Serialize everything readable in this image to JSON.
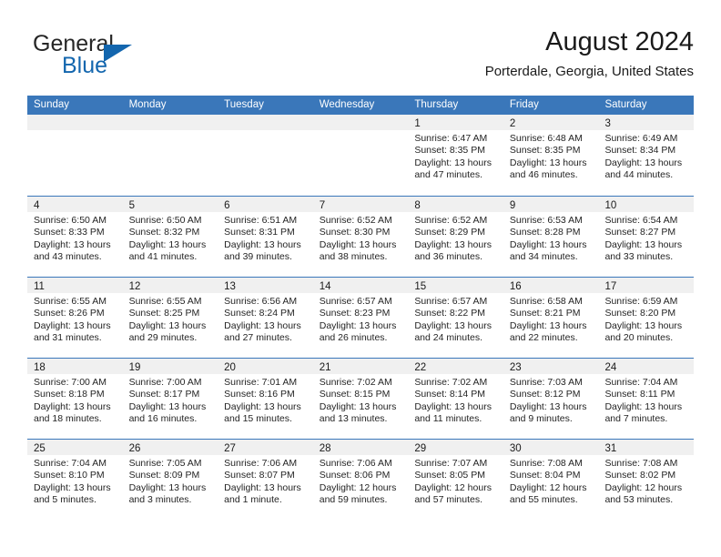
{
  "brand": {
    "word_one": "General",
    "word_two": "Blue",
    "flag_icon": "blue-triangle-flag-icon"
  },
  "header": {
    "title": "August 2024",
    "subtitle": "Porterdale, Georgia, United States"
  },
  "colors": {
    "header_blue": "#3a77ba",
    "brand_blue": "#1366ae",
    "day_band_gray": "#f0f0f0",
    "text": "#1a1a1a"
  },
  "weekdays": [
    "Sunday",
    "Monday",
    "Tuesday",
    "Wednesday",
    "Thursday",
    "Friday",
    "Saturday"
  ],
  "weeks": [
    [
      {
        "day": "",
        "sunrise": "",
        "sunset": "",
        "daylight": "",
        "daylight2": ""
      },
      {
        "day": "",
        "sunrise": "",
        "sunset": "",
        "daylight": "",
        "daylight2": ""
      },
      {
        "day": "",
        "sunrise": "",
        "sunset": "",
        "daylight": "",
        "daylight2": ""
      },
      {
        "day": "",
        "sunrise": "",
        "sunset": "",
        "daylight": "",
        "daylight2": ""
      },
      {
        "day": "1",
        "sunrise": "Sunrise: 6:47 AM",
        "sunset": "Sunset: 8:35 PM",
        "daylight": "Daylight: 13 hours",
        "daylight2": "and 47 minutes."
      },
      {
        "day": "2",
        "sunrise": "Sunrise: 6:48 AM",
        "sunset": "Sunset: 8:35 PM",
        "daylight": "Daylight: 13 hours",
        "daylight2": "and 46 minutes."
      },
      {
        "day": "3",
        "sunrise": "Sunrise: 6:49 AM",
        "sunset": "Sunset: 8:34 PM",
        "daylight": "Daylight: 13 hours",
        "daylight2": "and 44 minutes."
      }
    ],
    [
      {
        "day": "4",
        "sunrise": "Sunrise: 6:50 AM",
        "sunset": "Sunset: 8:33 PM",
        "daylight": "Daylight: 13 hours",
        "daylight2": "and 43 minutes."
      },
      {
        "day": "5",
        "sunrise": "Sunrise: 6:50 AM",
        "sunset": "Sunset: 8:32 PM",
        "daylight": "Daylight: 13 hours",
        "daylight2": "and 41 minutes."
      },
      {
        "day": "6",
        "sunrise": "Sunrise: 6:51 AM",
        "sunset": "Sunset: 8:31 PM",
        "daylight": "Daylight: 13 hours",
        "daylight2": "and 39 minutes."
      },
      {
        "day": "7",
        "sunrise": "Sunrise: 6:52 AM",
        "sunset": "Sunset: 8:30 PM",
        "daylight": "Daylight: 13 hours",
        "daylight2": "and 38 minutes."
      },
      {
        "day": "8",
        "sunrise": "Sunrise: 6:52 AM",
        "sunset": "Sunset: 8:29 PM",
        "daylight": "Daylight: 13 hours",
        "daylight2": "and 36 minutes."
      },
      {
        "day": "9",
        "sunrise": "Sunrise: 6:53 AM",
        "sunset": "Sunset: 8:28 PM",
        "daylight": "Daylight: 13 hours",
        "daylight2": "and 34 minutes."
      },
      {
        "day": "10",
        "sunrise": "Sunrise: 6:54 AM",
        "sunset": "Sunset: 8:27 PM",
        "daylight": "Daylight: 13 hours",
        "daylight2": "and 33 minutes."
      }
    ],
    [
      {
        "day": "11",
        "sunrise": "Sunrise: 6:55 AM",
        "sunset": "Sunset: 8:26 PM",
        "daylight": "Daylight: 13 hours",
        "daylight2": "and 31 minutes."
      },
      {
        "day": "12",
        "sunrise": "Sunrise: 6:55 AM",
        "sunset": "Sunset: 8:25 PM",
        "daylight": "Daylight: 13 hours",
        "daylight2": "and 29 minutes."
      },
      {
        "day": "13",
        "sunrise": "Sunrise: 6:56 AM",
        "sunset": "Sunset: 8:24 PM",
        "daylight": "Daylight: 13 hours",
        "daylight2": "and 27 minutes."
      },
      {
        "day": "14",
        "sunrise": "Sunrise: 6:57 AM",
        "sunset": "Sunset: 8:23 PM",
        "daylight": "Daylight: 13 hours",
        "daylight2": "and 26 minutes."
      },
      {
        "day": "15",
        "sunrise": "Sunrise: 6:57 AM",
        "sunset": "Sunset: 8:22 PM",
        "daylight": "Daylight: 13 hours",
        "daylight2": "and 24 minutes."
      },
      {
        "day": "16",
        "sunrise": "Sunrise: 6:58 AM",
        "sunset": "Sunset: 8:21 PM",
        "daylight": "Daylight: 13 hours",
        "daylight2": "and 22 minutes."
      },
      {
        "day": "17",
        "sunrise": "Sunrise: 6:59 AM",
        "sunset": "Sunset: 8:20 PM",
        "daylight": "Daylight: 13 hours",
        "daylight2": "and 20 minutes."
      }
    ],
    [
      {
        "day": "18",
        "sunrise": "Sunrise: 7:00 AM",
        "sunset": "Sunset: 8:18 PM",
        "daylight": "Daylight: 13 hours",
        "daylight2": "and 18 minutes."
      },
      {
        "day": "19",
        "sunrise": "Sunrise: 7:00 AM",
        "sunset": "Sunset: 8:17 PM",
        "daylight": "Daylight: 13 hours",
        "daylight2": "and 16 minutes."
      },
      {
        "day": "20",
        "sunrise": "Sunrise: 7:01 AM",
        "sunset": "Sunset: 8:16 PM",
        "daylight": "Daylight: 13 hours",
        "daylight2": "and 15 minutes."
      },
      {
        "day": "21",
        "sunrise": "Sunrise: 7:02 AM",
        "sunset": "Sunset: 8:15 PM",
        "daylight": "Daylight: 13 hours",
        "daylight2": "and 13 minutes."
      },
      {
        "day": "22",
        "sunrise": "Sunrise: 7:02 AM",
        "sunset": "Sunset: 8:14 PM",
        "daylight": "Daylight: 13 hours",
        "daylight2": "and 11 minutes."
      },
      {
        "day": "23",
        "sunrise": "Sunrise: 7:03 AM",
        "sunset": "Sunset: 8:12 PM",
        "daylight": "Daylight: 13 hours",
        "daylight2": "and 9 minutes."
      },
      {
        "day": "24",
        "sunrise": "Sunrise: 7:04 AM",
        "sunset": "Sunset: 8:11 PM",
        "daylight": "Daylight: 13 hours",
        "daylight2": "and 7 minutes."
      }
    ],
    [
      {
        "day": "25",
        "sunrise": "Sunrise: 7:04 AM",
        "sunset": "Sunset: 8:10 PM",
        "daylight": "Daylight: 13 hours",
        "daylight2": "and 5 minutes."
      },
      {
        "day": "26",
        "sunrise": "Sunrise: 7:05 AM",
        "sunset": "Sunset: 8:09 PM",
        "daylight": "Daylight: 13 hours",
        "daylight2": "and 3 minutes."
      },
      {
        "day": "27",
        "sunrise": "Sunrise: 7:06 AM",
        "sunset": "Sunset: 8:07 PM",
        "daylight": "Daylight: 13 hours",
        "daylight2": "and 1 minute."
      },
      {
        "day": "28",
        "sunrise": "Sunrise: 7:06 AM",
        "sunset": "Sunset: 8:06 PM",
        "daylight": "Daylight: 12 hours",
        "daylight2": "and 59 minutes."
      },
      {
        "day": "29",
        "sunrise": "Sunrise: 7:07 AM",
        "sunset": "Sunset: 8:05 PM",
        "daylight": "Daylight: 12 hours",
        "daylight2": "and 57 minutes."
      },
      {
        "day": "30",
        "sunrise": "Sunrise: 7:08 AM",
        "sunset": "Sunset: 8:04 PM",
        "daylight": "Daylight: 12 hours",
        "daylight2": "and 55 minutes."
      },
      {
        "day": "31",
        "sunrise": "Sunrise: 7:08 AM",
        "sunset": "Sunset: 8:02 PM",
        "daylight": "Daylight: 12 hours",
        "daylight2": "and 53 minutes."
      }
    ]
  ]
}
